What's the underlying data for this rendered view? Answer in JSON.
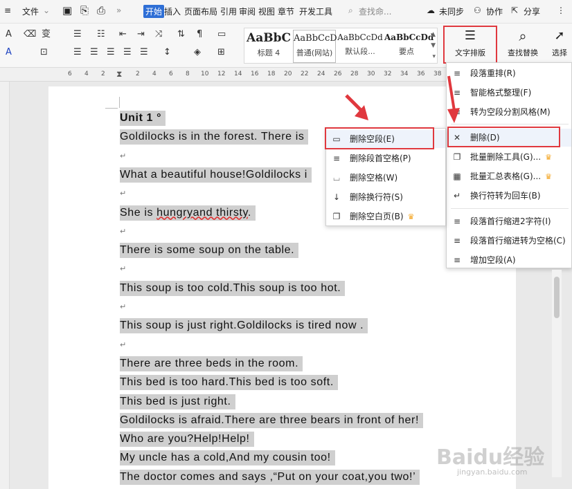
{
  "topbar": {
    "file_menu": "文件",
    "tabs": [
      "开始",
      "插入",
      "页面布局",
      "引用",
      "审阅",
      "视图",
      "章节",
      "开发工具"
    ],
    "search_placeholder": "查找命...",
    "sync_label": "未同步",
    "collab_label": "协作",
    "share_label": "分享"
  },
  "ribbon": {
    "styles": [
      {
        "sample": "AaBbC",
        "name": "标题 4"
      },
      {
        "sample": "AaBbCcD",
        "name": "普通(网站)"
      },
      {
        "sample": "AaBbCcDd",
        "name": "默认段..."
      },
      {
        "sample": "AaBbCcDd",
        "name": "要点"
      }
    ],
    "text_layout_label": "文字排版",
    "find_replace_label": "查找替换",
    "select_label": "选择"
  },
  "ruler": {
    "ticks": [
      "6",
      "4",
      "2",
      "2",
      "4",
      "6",
      "8",
      "10",
      "12",
      "14",
      "16",
      "18",
      "20",
      "22",
      "24",
      "26",
      "28",
      "30",
      "32",
      "34",
      "36",
      "38",
      "40"
    ]
  },
  "document": {
    "lines": [
      {
        "text": "Unit 1 °",
        "bold": true,
        "blank_after": false
      },
      {
        "text": "Goldilocks is in the forest. There is",
        "blank_after": true
      },
      {
        "text": "What a beautiful house!Goldilocks i",
        "blank_after": true
      },
      {
        "text": "She is hungryand thirsty.",
        "blank_after": true
      },
      {
        "text": "There is some soup on the table.",
        "blank_after": true
      },
      {
        "text": "This soup is too cold.This soup is too hot.",
        "blank_after": true
      },
      {
        "text": "This soup is just right.Goldilocks is tired now .",
        "blank_after": true
      },
      {
        "text": "There are three beds in the room.",
        "blank_after": false
      },
      {
        "text": "This bed is too hard.This bed is too soft.",
        "blank_after": false
      },
      {
        "text": "This bed is just right.",
        "blank_after": false
      },
      {
        "text": "Goldilocks is afraid.There are three bears in front of her!",
        "blank_after": false
      },
      {
        "text": "Who are you?Help!Help!",
        "blank_after": false
      },
      {
        "text": "My uncle has a cold,And my cousin too!",
        "blank_after": false
      },
      {
        "text": "The doctor comes and says ,“Put on your coat,you two!’",
        "blank_after": false
      }
    ],
    "para_mark": "↵"
  },
  "text_layout_menu": {
    "items": [
      {
        "icon": "paragraph-rearrange-icon",
        "glyph": "≡",
        "label": "段落重排(R)"
      },
      {
        "icon": "smart-format-icon",
        "glyph": "≡",
        "label": "智能格式整理(F)"
      },
      {
        "icon": "split-style-icon",
        "glyph": "≡",
        "label": "转为空段分割风格(M)"
      },
      {
        "icon": "delete-icon",
        "glyph": "✕",
        "label": "删除(D)"
      },
      {
        "icon": "batch-delete-icon",
        "glyph": "❐",
        "label": "批量删除工具(G)...",
        "vip": true
      },
      {
        "icon": "batch-summary-icon",
        "glyph": "▦",
        "label": "批量汇总表格(G)...",
        "vip": true
      },
      {
        "icon": "newline-to-enter-icon",
        "glyph": "↵",
        "label": "换行符转为回车(B)"
      },
      {
        "icon": "indent-2-chars-icon",
        "glyph": "≡",
        "label": "段落首行缩进2字符(I)"
      },
      {
        "icon": "indent-to-space-icon",
        "glyph": "≡",
        "label": "段落首行缩进转为空格(C)"
      },
      {
        "icon": "add-blank-para-icon",
        "glyph": "≡",
        "label": "增加空段(A)"
      }
    ]
  },
  "delete_submenu": {
    "items": [
      {
        "icon": "delete-blank-para-icon",
        "glyph": "▭",
        "label": "删除空段(E)"
      },
      {
        "icon": "delete-leading-space-icon",
        "glyph": "≡",
        "label": "删除段首空格(P)"
      },
      {
        "icon": "delete-space-icon",
        "glyph": "⌴",
        "label": "删除空格(W)"
      },
      {
        "icon": "delete-linebreak-icon",
        "glyph": "↓",
        "label": "删除换行符(S)"
      },
      {
        "icon": "delete-blank-page-icon",
        "glyph": "❐",
        "label": "删除空白页(B)",
        "vip": true
      }
    ]
  },
  "watermark": {
    "text": "Baidu经验",
    "sub": "jingyan.baidu.com"
  },
  "colors": {
    "accent": "#2f6fd6",
    "highlight": "#e0383e",
    "selection": "#cfcfcf"
  }
}
